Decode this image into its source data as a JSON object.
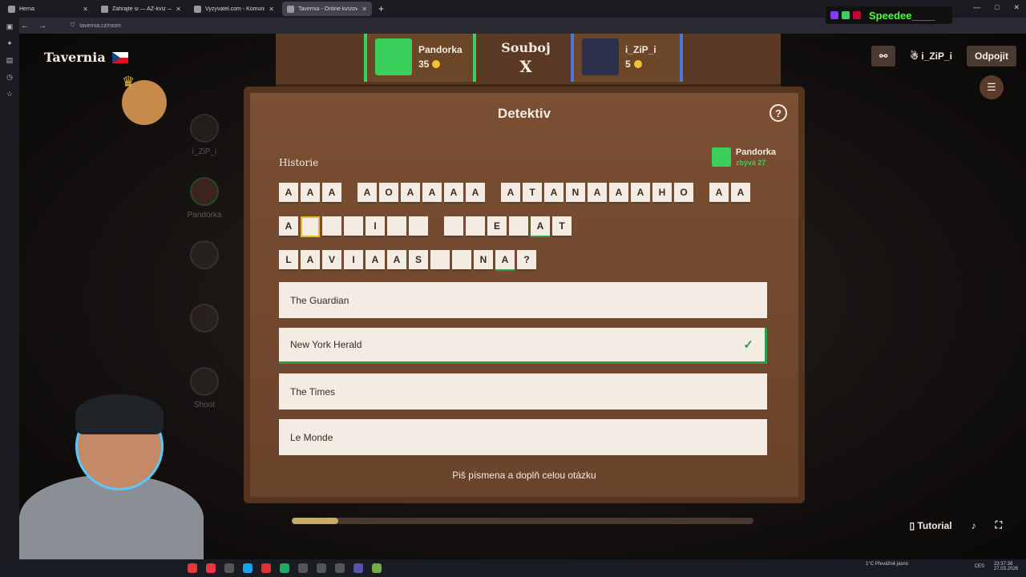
{
  "browser": {
    "tabs": [
      {
        "title": "Herna",
        "active": false
      },
      {
        "title": "Zahrajte si — AZ-kvíz — Český",
        "active": false
      },
      {
        "title": "Vyzyvatel.com - Komunitní vě",
        "active": false
      },
      {
        "title": "Tavernia - Online kvízová hr",
        "active": true
      }
    ],
    "new_tab": "+",
    "url": "tavernia.cz/room",
    "window_controls": [
      "—",
      "□",
      "✕"
    ]
  },
  "site": {
    "logo": "Tavernia",
    "language": "CZ"
  },
  "scoreboard": {
    "player1": {
      "name": "Pandorka",
      "score": "35"
    },
    "mode": "Souboj",
    "vs": "X",
    "player2": {
      "name": "i_ZiP_i",
      "score": "5"
    }
  },
  "top_right": {
    "user": "i_ZiP_i",
    "disconnect": "Odpojit"
  },
  "twitch": {
    "name": "Speedee____"
  },
  "players": [
    {
      "name": "i_ZiP_i",
      "me": false
    },
    {
      "name": "Pandorka",
      "me": true
    },
    {
      "name": "",
      "me": false
    },
    {
      "name": "",
      "me": false
    },
    {
      "name": "Shoot",
      "me": false
    }
  ],
  "game": {
    "title": "Detektiv",
    "category": "Historie",
    "turn_player": "Pandorka",
    "turn_left": "zbývá 27",
    "rows": [
      [
        "A",
        "A",
        "A",
        " ",
        "A",
        "O",
        "A",
        "A",
        "A",
        "A",
        " ",
        "A",
        "T",
        "A",
        "N",
        "A",
        "A",
        "A",
        "H",
        "O",
        " ",
        "A",
        "A"
      ],
      [
        "A",
        "",
        "",
        "",
        "I",
        "",
        "",
        " ",
        "",
        "",
        "E",
        "",
        "A",
        "T"
      ],
      [
        "L",
        "A",
        "V",
        "I",
        "A",
        "A",
        "S",
        "",
        "",
        "N",
        "A",
        "?"
      ]
    ],
    "options": [
      {
        "label": "The Guardian",
        "correct": false
      },
      {
        "label": "New York Herald",
        "correct": true
      },
      {
        "label": "The Times",
        "correct": false
      },
      {
        "label": "Le Monde",
        "correct": false
      }
    ],
    "hint": "Piš písmena a doplň celou otázku",
    "timer_fraction": 0.1
  },
  "footer": {
    "tutorial": "Tutorial"
  },
  "tray": {
    "weather": "1°C Převážně jasno",
    "lang": "CES",
    "time": "23:37:38",
    "date": "27.03.2026"
  }
}
